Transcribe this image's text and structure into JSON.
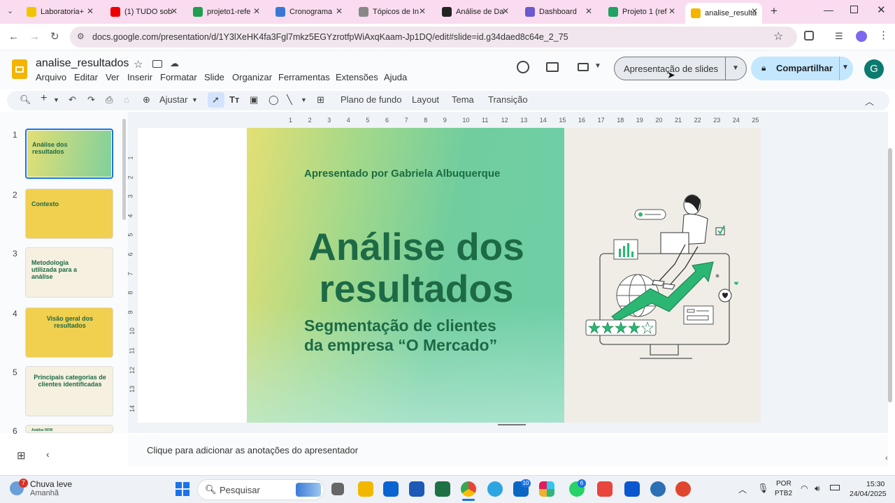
{
  "browser": {
    "tabs": [
      {
        "title": "Laboratoria+",
        "color": "#f2c400"
      },
      {
        "title": "(1) TUDO sob",
        "color": "#e00"
      },
      {
        "title": "projeto1-refe",
        "color": "#1e9e4e"
      },
      {
        "title": "Cronograma",
        "color": "#3a78d8"
      },
      {
        "title": "Tópicos de In",
        "color": "#888"
      },
      {
        "title": "Análise de Da",
        "color": "#222"
      },
      {
        "title": "Dashboard",
        "color": "#6a5acd"
      },
      {
        "title": "Projeto 1 (ref",
        "color": "#1ea362"
      },
      {
        "title": "analise_resulta",
        "color": "#f4b400"
      }
    ],
    "url": "docs.google.com/presentation/d/1Y3lXeHK4fa3Fgl7mkz5EGYzrotfpWiAxqKaam-Jp1DQ/edit#slide=id.g34daed8c64e_2_75"
  },
  "doc": {
    "title": "analise_resultados",
    "menus": [
      "Arquivo",
      "Editar",
      "Ver",
      "Inserir",
      "Formatar",
      "Slide",
      "Organizar",
      "Ferramentas",
      "Extensões",
      "Ajuda"
    ],
    "slideshow_label": "Apresentação de slides",
    "share_label": "Compartilhar",
    "avatar": "G"
  },
  "toolbar": {
    "fit": "Ajustar",
    "background": "Plano de fundo",
    "layout": "Layout",
    "theme": "Tema",
    "transition": "Transição"
  },
  "thumbnails": [
    {
      "num": "1",
      "title": "Análise dos resultados"
    },
    {
      "num": "2",
      "title": "Contexto"
    },
    {
      "num": "3",
      "title": "Metodologia utilizada para a análise"
    },
    {
      "num": "4",
      "title": "Visão geral dos resultados"
    },
    {
      "num": "5",
      "title": "Principais categorias de clientes identificadas"
    },
    {
      "num": "6",
      "title": "Análise RFM"
    }
  ],
  "slide": {
    "presenter": "Apresentado por Gabriela Albuquerque",
    "title_line1": "Análise dos",
    "title_line2": "resultados",
    "subtitle_line1": "Segmentação de clientes",
    "subtitle_line2": "da empresa “O Mercado”"
  },
  "ruler_h": [
    "1",
    "2",
    "3",
    "4",
    "5",
    "6",
    "7",
    "8",
    "9",
    "10",
    "11",
    "12",
    "13",
    "14",
    "15",
    "16",
    "17",
    "18",
    "19",
    "20",
    "21",
    "22",
    "23",
    "24",
    "25"
  ],
  "ruler_v": [
    "1",
    "2",
    "3",
    "4",
    "5",
    "6",
    "7",
    "8",
    "9",
    "10",
    "11",
    "12",
    "13",
    "14"
  ],
  "notes_placeholder": "Clique para adicionar as anotações do apresentador",
  "taskbar": {
    "weather_temp": "7",
    "weather_title": "Chuva leve",
    "weather_sub": "Amanhã",
    "search_label": "Pesquisar",
    "lang1": "POR",
    "lang2": "PTB2",
    "time": "15:30",
    "date": "24/04/2025",
    "badge_a": "10",
    "badge_b": "6"
  }
}
